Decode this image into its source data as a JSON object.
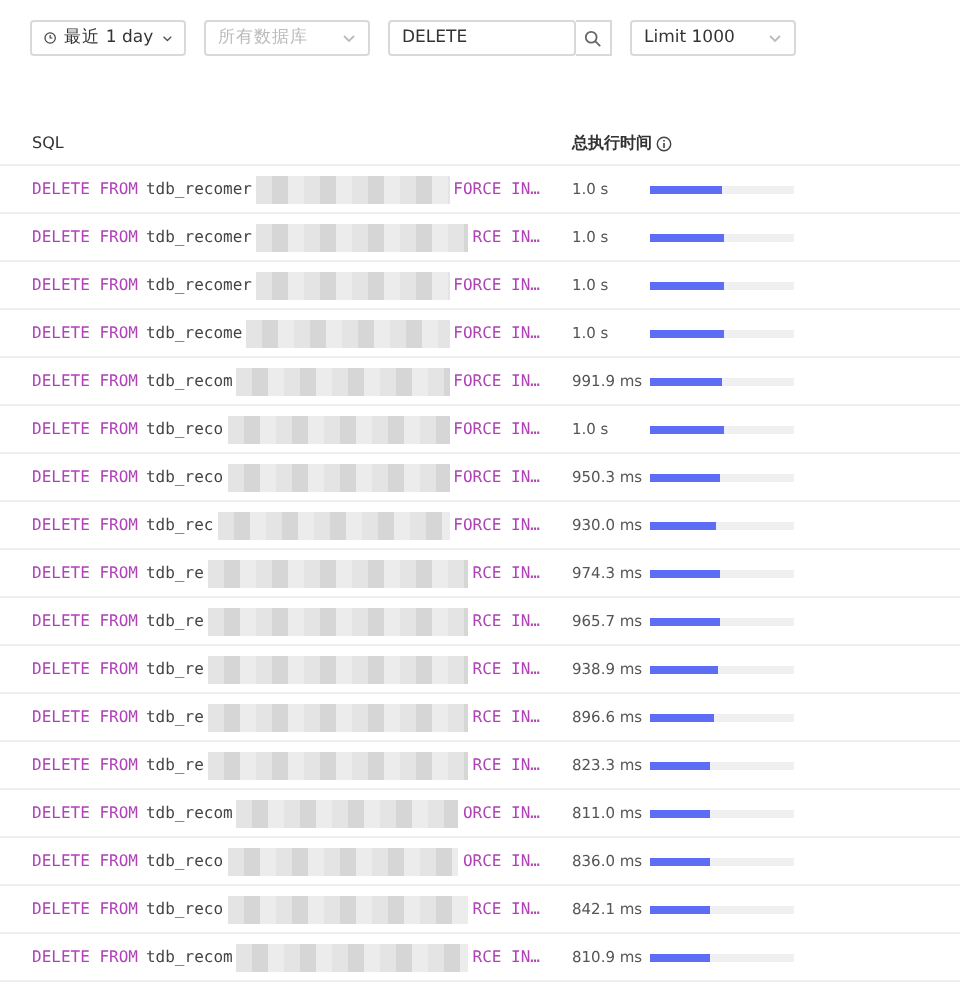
{
  "filters": {
    "time_range": "最近 1 day",
    "database": {
      "placeholder": "所有数据库"
    },
    "search": {
      "value": "DELETE"
    },
    "limit": "Limit 1000"
  },
  "table": {
    "columns": [
      "SQL",
      "总执行时间"
    ],
    "rows": [
      {
        "keyword": "DELETE FROM",
        "table": "tdb_recomer",
        "tail": "FORCE IN…",
        "time": "1.0 s",
        "level": 0.5
      },
      {
        "keyword": "DELETE FROM",
        "table": "tdb_recomer",
        "tail": "RCE IN…",
        "time": "1.0 s",
        "level": 0.51
      },
      {
        "keyword": "DELETE FROM",
        "table": "tdb_recomer",
        "tail": "FORCE IN…",
        "time": "1.0 s",
        "level": 0.51
      },
      {
        "keyword": "DELETE FROM",
        "table": "tdb_recome",
        "tail": "FORCE IN…",
        "time": "1.0 s",
        "level": 0.51
      },
      {
        "keyword": "DELETE FROM",
        "table": "tdb_recom",
        "tail": "FORCE IN…",
        "time": "991.9 ms",
        "level": 0.5
      },
      {
        "keyword": "DELETE FROM",
        "table": "tdb_reco",
        "tail": "FORCE IN…",
        "time": "1.0 s",
        "level": 0.51
      },
      {
        "keyword": "DELETE FROM",
        "table": "tdb_reco",
        "tail": "FORCE IN…",
        "time": "950.3 ms",
        "level": 0.48
      },
      {
        "keyword": "DELETE FROM",
        "table": "tdb_rec",
        "tail": "FORCE IN…",
        "time": "930.0 ms",
        "level": 0.46
      },
      {
        "keyword": "DELETE FROM",
        "table": "tdb_re",
        "tail": "RCE IN…",
        "time": "974.3 ms",
        "level": 0.48
      },
      {
        "keyword": "DELETE FROM",
        "table": "tdb_re",
        "tail": "RCE IN…",
        "time": "965.7 ms",
        "level": 0.48
      },
      {
        "keyword": "DELETE FROM",
        "table": "tdb_re",
        "tail": "RCE IN…",
        "time": "938.9 ms",
        "level": 0.47
      },
      {
        "keyword": "DELETE FROM",
        "table": "tdb_re",
        "tail": "RCE IN…",
        "time": "896.6 ms",
        "level": 0.45
      },
      {
        "keyword": "DELETE FROM",
        "table": "tdb_re",
        "tail": "RCE IN…",
        "time": "823.3 ms",
        "level": 0.41
      },
      {
        "keyword": "DELETE FROM",
        "table": "tdb_recom",
        "tail": "ORCE IN…",
        "time": "811.0 ms",
        "level": 0.41
      },
      {
        "keyword": "DELETE FROM",
        "table": "tdb_reco",
        "tail": "ORCE IN…",
        "time": "836.0 ms",
        "level": 0.41
      },
      {
        "keyword": "DELETE FROM",
        "table": "tdb_reco",
        "tail": "RCE IN…",
        "time": "842.1 ms",
        "level": 0.42
      },
      {
        "keyword": "DELETE FROM",
        "table": "tdb_recom",
        "tail": "RCE IN…",
        "time": "810.9 ms",
        "level": 0.41
      }
    ]
  }
}
